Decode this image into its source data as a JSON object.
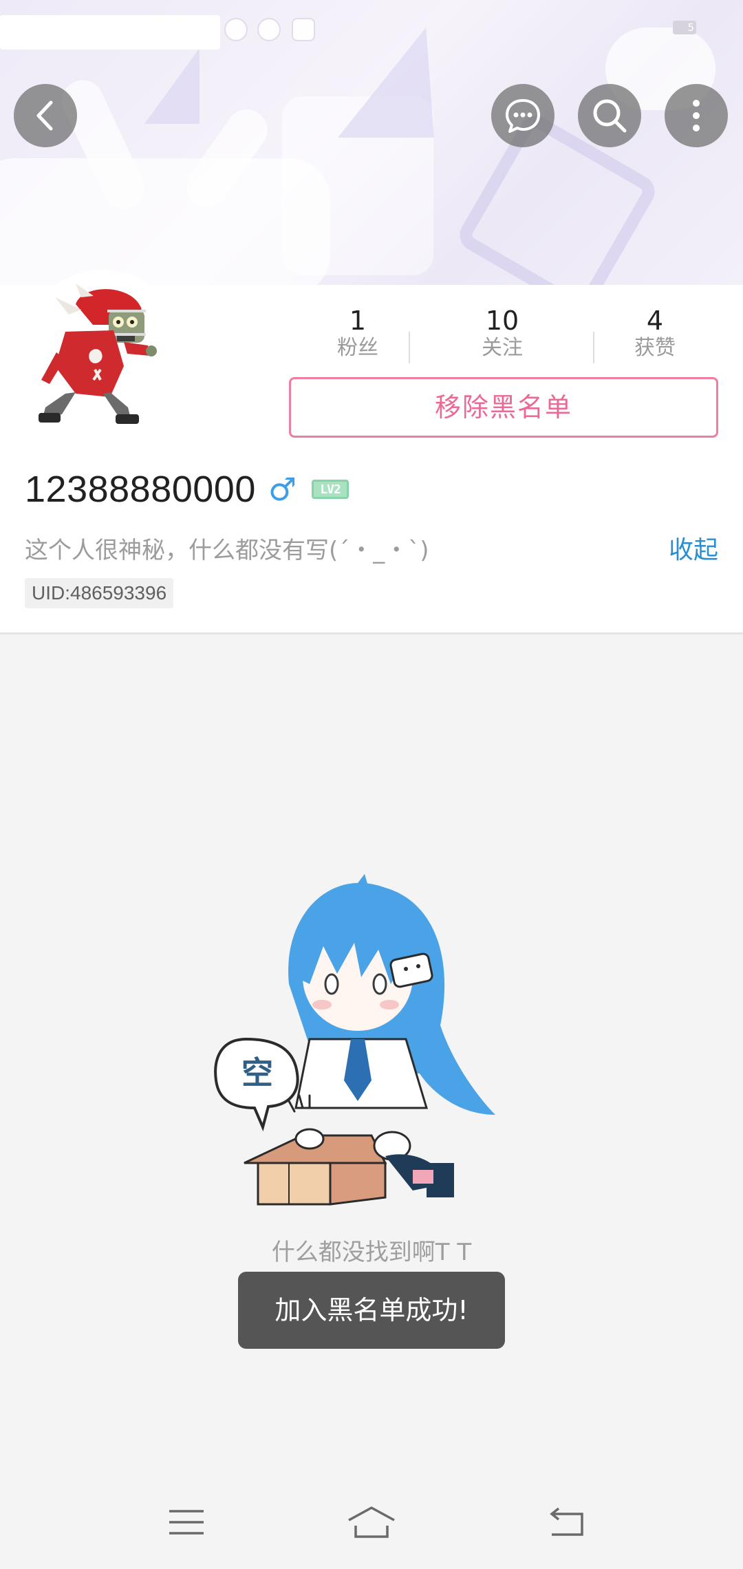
{
  "status_bar": {
    "battery_level": "5"
  },
  "header": {
    "icons": {
      "back": "chevron-left-icon",
      "message": "chat-bubble-icon",
      "search": "search-icon",
      "more": "more-vertical-icon"
    }
  },
  "profile": {
    "stats": [
      {
        "value": "1",
        "label": "粉丝"
      },
      {
        "value": "10",
        "label": "关注"
      },
      {
        "value": "4",
        "label": "获赞"
      }
    ],
    "unblock_label": "移除黑名单",
    "username": "12388880000",
    "gender_symbol": "♂",
    "level": "LV2",
    "bio": "这个人很神秘，什么都没有写(´・_・`)",
    "collapse_label": "收起",
    "uid": "UID:486593396"
  },
  "empty_state": {
    "bubble_text": "空",
    "message": "什么都没找到啊T T"
  },
  "toast": {
    "message": "加入黑名单成功!"
  },
  "navbar": {
    "icons": [
      "menu-icon",
      "home-icon",
      "back-icon"
    ]
  },
  "colors": {
    "accent_pink": "#eb6a93",
    "link_blue": "#2a8fd0",
    "gender_blue": "#3d9ee8",
    "level_green": "#86d3a8"
  }
}
